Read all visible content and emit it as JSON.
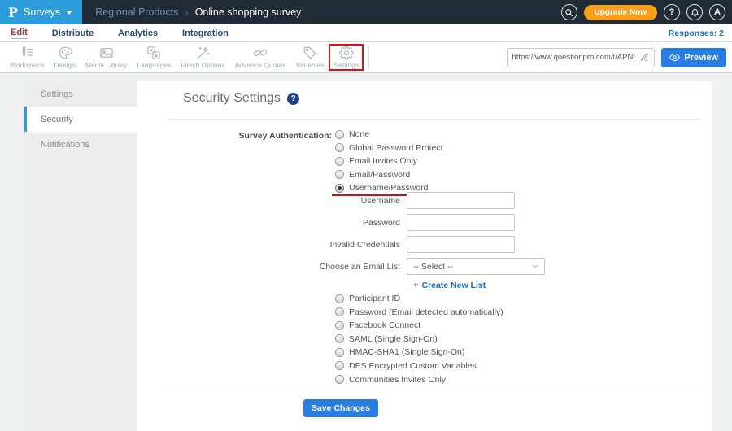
{
  "colors": {
    "topbar_bg": "#212b36",
    "brand_blue": "#2d9cdb",
    "upgrade_orange": "#f9a01b",
    "active_tab_red": "#9e3232",
    "link_blue": "#1a6fb5",
    "primary_button_blue": "#2a7de2",
    "annotation_red": "#cc1111"
  },
  "topbar": {
    "logo_letter": "P",
    "surveys_label": "Surveys",
    "breadcrumb": {
      "folder": "Regional Products",
      "separator": "›",
      "survey": "Online shopping survey"
    },
    "upgrade_label": "Upgrade Now",
    "help_label": "?",
    "avatar_label": "A"
  },
  "tabs": {
    "items": [
      {
        "label": "Edit",
        "active": true
      },
      {
        "label": "Distribute",
        "active": false
      },
      {
        "label": "Analytics",
        "active": false
      },
      {
        "label": "Integration",
        "active": false
      }
    ],
    "responses": "Responses: 2"
  },
  "toolbar": {
    "items": [
      {
        "label": "Workspace",
        "icon": "workspace-icon"
      },
      {
        "label": "Design",
        "icon": "design-icon"
      },
      {
        "label": "Media Library",
        "icon": "media-library-icon"
      },
      {
        "label": "Languages",
        "icon": "languages-icon"
      },
      {
        "label": "Finish Options",
        "icon": "finish-options-icon"
      },
      {
        "label": "Advance Quotas",
        "icon": "advance-quotas-icon"
      },
      {
        "label": "Variables",
        "icon": "variables-icon"
      },
      {
        "label": "Settings",
        "icon": "settings-icon",
        "highlighted": true
      }
    ],
    "survey_url": "https://www.questionpro.com/t/APNrFZ",
    "preview_label": "Preview"
  },
  "sidebar": {
    "items": [
      {
        "label": "Settings",
        "active": false
      },
      {
        "label": "Security",
        "active": true
      },
      {
        "label": "Notifications",
        "active": false
      }
    ]
  },
  "main": {
    "title": "Security Settings",
    "auth_label": "Survey Authentication:",
    "auth_options_top": [
      "None",
      "Global Password Protect",
      "Email Invites Only",
      "Email/Password",
      "Username/Password"
    ],
    "selected_auth": "Username/Password",
    "fields": [
      {
        "label": "Username",
        "value": ""
      },
      {
        "label": "Password",
        "value": ""
      },
      {
        "label": "Invalid Credentials",
        "value": ""
      }
    ],
    "email_list_label": "Choose an Email List",
    "email_list_selected": "-- Select --",
    "create_list_plus": "+",
    "create_list_label": "Create New List",
    "auth_options_bottom": [
      "Participant ID",
      "Password (Email detected automatically)",
      "Facebook Connect",
      "SAML (Single Sign-On)",
      "HMAC-SHA1 (Single Sign-On)",
      "DES Encrypted Custom Variables",
      "Communities Invites Only"
    ],
    "save_label": "Save Changes"
  }
}
